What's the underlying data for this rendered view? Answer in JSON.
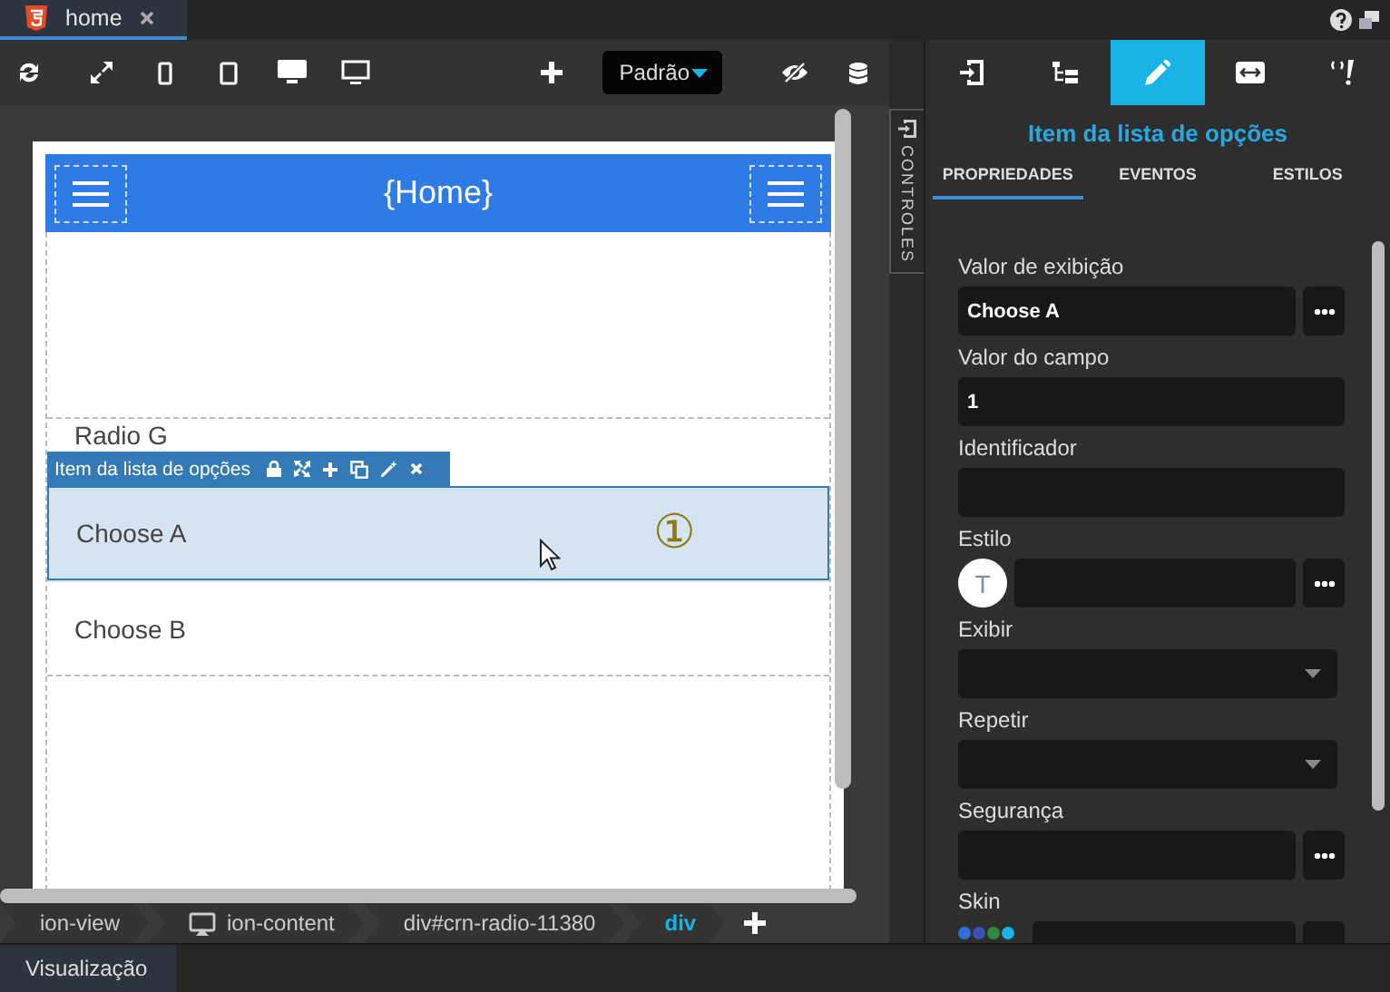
{
  "document_tab": {
    "title": "home"
  },
  "toolbar": {
    "preset": "Padrão"
  },
  "canvas": {
    "header_title": "{Home}",
    "list_items": [
      {
        "label": "Radio G",
        "selected": false
      },
      {
        "label": "Choose A",
        "selected": true
      },
      {
        "label": "Choose B",
        "selected": false
      }
    ],
    "selection_toolbar": {
      "label": "Item da lista de opções"
    },
    "badge": "①"
  },
  "side_strip": {
    "label": "CONTROLES"
  },
  "panel": {
    "tabs": [
      {
        "kind": "enter",
        "selected": false
      },
      {
        "kind": "tree",
        "selected": false
      },
      {
        "kind": "edit",
        "selected": true
      },
      {
        "kind": "resize",
        "selected": false
      },
      {
        "kind": "code",
        "selected": false
      }
    ],
    "title": "Item da lista de opções",
    "subtabs": [
      {
        "label": "PROPRIEDADES",
        "selected": true
      },
      {
        "label": "EVENTOS",
        "selected": false
      },
      {
        "label": "ESTILOS",
        "selected": false
      }
    ],
    "fields": [
      {
        "label": "Valor de exibição",
        "kind": "text_more",
        "value": "Choose A"
      },
      {
        "label": "Valor do campo",
        "kind": "text",
        "value": "1"
      },
      {
        "label": "Identificador",
        "kind": "text"
      },
      {
        "label": "Estilo",
        "kind": "style",
        "avatar": "T"
      },
      {
        "label": "Exibir",
        "kind": "select"
      },
      {
        "label": "Repetir",
        "kind": "select"
      },
      {
        "label": "Segurança",
        "kind": "text_more"
      },
      {
        "label": "Skin",
        "kind": "skin",
        "swatches": [
          {
            "color": "#2f6fd8"
          },
          {
            "color": "#3c4fb4"
          },
          {
            "color": "#2e8b3e"
          },
          {
            "color": "#1ab3e8"
          }
        ]
      }
    ]
  },
  "breadcrumbs": [
    {
      "label": "ion-view",
      "kind": "plain",
      "selected": false
    },
    {
      "label": "ion-content",
      "kind": "screen",
      "selected": false
    },
    {
      "label": "div#crn-radio-11380",
      "kind": "plain",
      "selected": false
    },
    {
      "label": "div",
      "kind": "plain",
      "selected": true
    }
  ],
  "footer": {
    "tabs": [
      {
        "label": "Visualização"
      }
    ]
  }
}
